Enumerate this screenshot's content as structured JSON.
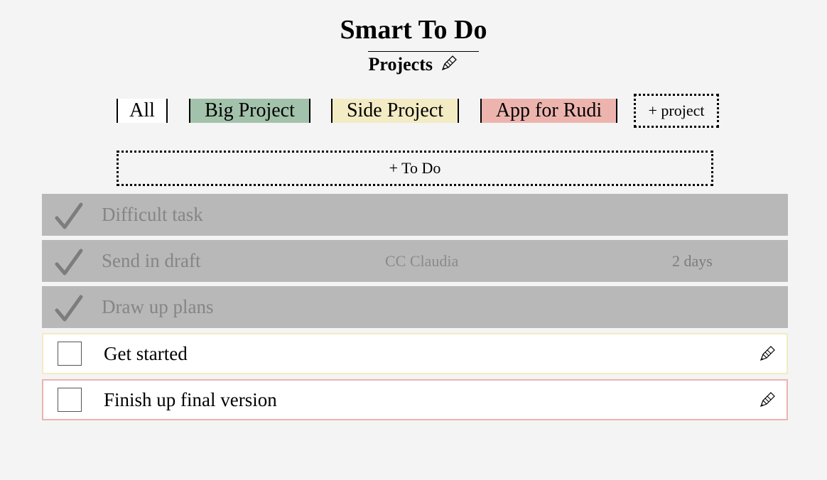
{
  "app": {
    "title": "Smart To Do",
    "subtitle": "Projects"
  },
  "tabs": [
    {
      "label": "All",
      "color": "#ffffff"
    },
    {
      "label": "Big Project",
      "color": "#a3c2ab"
    },
    {
      "label": "Side Project",
      "color": "#f3ebc4"
    },
    {
      "label": "App for Rudi",
      "color": "#edb4ae"
    }
  ],
  "add_project_label": "+ project",
  "add_todo_label": "+ To Do",
  "todos": [
    {
      "text": "Difficult task",
      "done": true
    },
    {
      "text": "Send in draft",
      "done": true,
      "cc": "CC Claudia",
      "due": "2 days"
    },
    {
      "text": "Draw up plans",
      "done": true
    },
    {
      "text": "Get started",
      "done": false,
      "project_color": "#f3ebc4"
    },
    {
      "text": "Finish up final version",
      "done": false,
      "project_color": "#edb4ae"
    }
  ],
  "icons": {
    "done": "checkmark-icon",
    "edit": "pencil-icon"
  }
}
